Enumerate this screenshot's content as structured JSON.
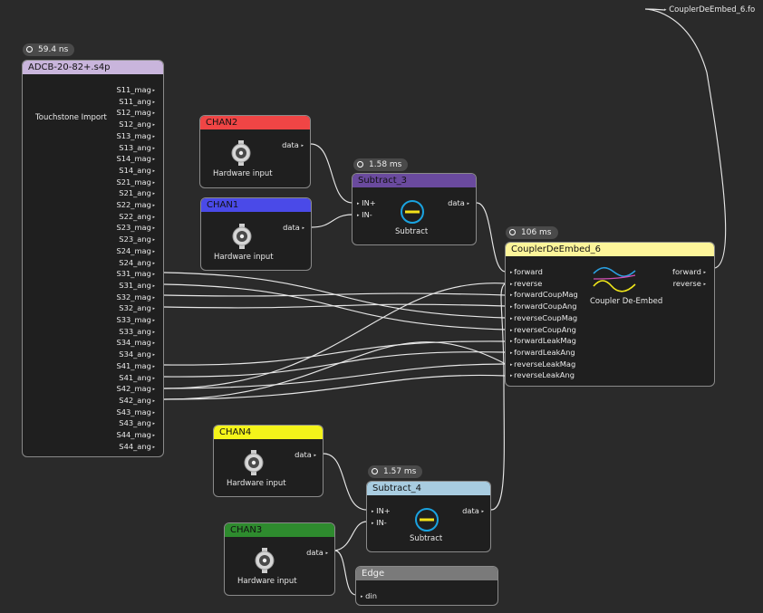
{
  "output_file": {
    "label": "CouplerDeEmbed_6.fo"
  },
  "adcb": {
    "timing": "59.4 ns",
    "title": "ADCB-20-82+.s4p",
    "caption": "Touchstone Import",
    "outputs": [
      "S11_mag",
      "S11_ang",
      "S12_mag",
      "S12_ang",
      "S13_mag",
      "S13_ang",
      "S14_mag",
      "S14_ang",
      "S21_mag",
      "S21_ang",
      "S22_mag",
      "S22_ang",
      "S23_mag",
      "S23_ang",
      "S24_mag",
      "S24_ang",
      "S31_mag",
      "S31_ang",
      "S32_mag",
      "S32_ang",
      "S33_mag",
      "S33_ang",
      "S34_mag",
      "S34_ang",
      "S41_mag",
      "S41_ang",
      "S42_mag",
      "S42_ang",
      "S43_mag",
      "S43_ang",
      "S44_mag",
      "S44_ang"
    ],
    "color": "#c9b5dc"
  },
  "chan2": {
    "title": "CHAN2",
    "output": "data",
    "caption": "Hardware input",
    "color": "#f04545"
  },
  "chan1": {
    "title": "CHAN1",
    "output": "data",
    "caption": "Hardware input",
    "color": "#4a4ae8"
  },
  "chan4": {
    "title": "CHAN4",
    "output": "data",
    "caption": "Hardware input",
    "color": "#f4f41a"
  },
  "chan3": {
    "title": "CHAN3",
    "output": "data",
    "caption": "Hardware input",
    "color": "#2e8b2e"
  },
  "subtract3": {
    "timing": "1.58 ms",
    "title": "Subtract_3",
    "inputs": [
      "IN+",
      "IN-"
    ],
    "output": "data",
    "caption": "Subtract",
    "color": "#6a4a9e"
  },
  "subtract4": {
    "timing": "1.57 ms",
    "title": "Subtract_4",
    "inputs": [
      "IN+",
      "IN-"
    ],
    "output": "data",
    "caption": "Subtract",
    "color": "#a8cce0"
  },
  "coupler": {
    "timing": "106 ms",
    "title": "CouplerDeEmbed_6",
    "caption": "Coupler De-Embed",
    "inputs": [
      "forward",
      "reverse",
      "forwardCoupMag",
      "forwardCoupAng",
      "reverseCoupMag",
      "reverseCoupAng",
      "forwardLeakMag",
      "forwardLeakAng",
      "reverseLeakMag",
      "reverseLeakAng"
    ],
    "outputs": [
      "forward",
      "reverse"
    ],
    "color": "#fdf59a"
  },
  "edge": {
    "title": "Edge",
    "input": "din",
    "color": "#7a7a7a"
  },
  "icons": {
    "hardware": "bnc-connector-icon",
    "subtract": "subtract-icon",
    "coupler": "coupler-waveform-icon",
    "timing": "clock-icon"
  }
}
